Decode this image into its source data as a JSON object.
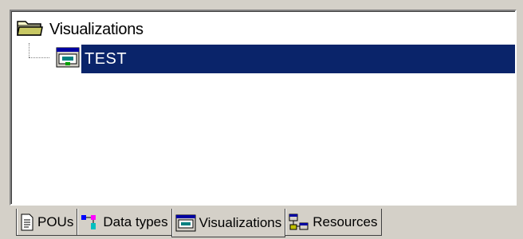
{
  "tree": {
    "root_label": "Visualizations",
    "child_label": "TEST"
  },
  "tabs": [
    {
      "label": "POUs"
    },
    {
      "label": "Data types"
    },
    {
      "label": "Visualizations"
    },
    {
      "label": "Resources"
    }
  ],
  "colors": {
    "selection": "#0a246a",
    "panel_bg": "#d4d0c8"
  }
}
